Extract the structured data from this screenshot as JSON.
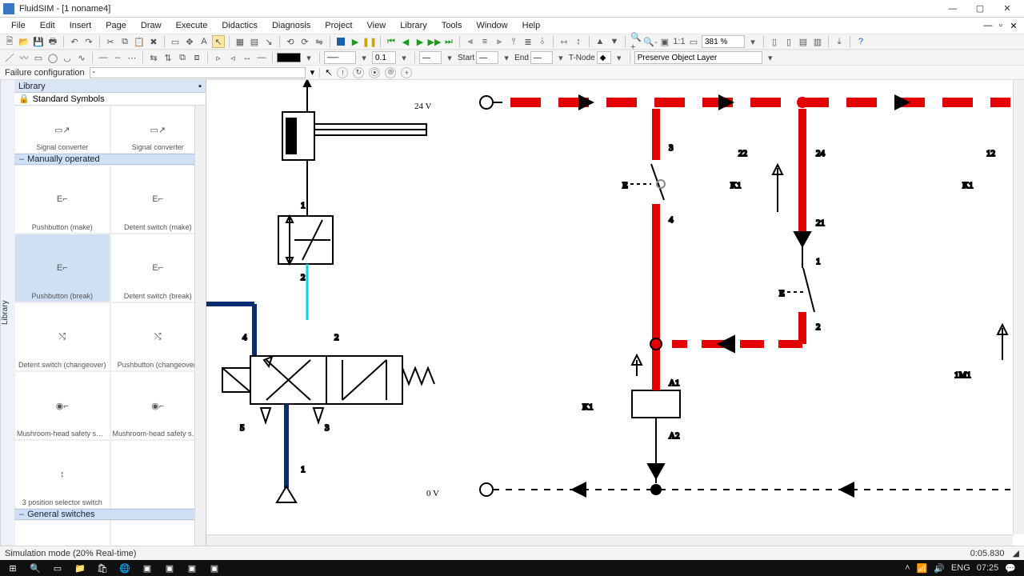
{
  "window": {
    "title": "FluidSIM - [1 noname4]"
  },
  "menu": [
    "File",
    "Edit",
    "Insert",
    "Page",
    "Draw",
    "Execute",
    "Didactics",
    "Diagnosis",
    "Project",
    "View",
    "Library",
    "Tools",
    "Window",
    "Help"
  ],
  "toolbar1": {
    "zoom": "381 %"
  },
  "toolbar2": {
    "line_weight": "0.1",
    "labels": {
      "start": "Start",
      "end": "End",
      "tnode": "T-Node",
      "preserve": "Preserve Object Layer"
    }
  },
  "failure": {
    "label": "Failure configuration",
    "value": "-"
  },
  "library": {
    "panel_title": "Library",
    "std_header": "Standard Symbols",
    "top_row": [
      "Signal converter",
      "Signal converter"
    ],
    "cat_manual": "Manually operated",
    "manual_items": [
      "Pushbutton (make)",
      "Detent switch (make)",
      "Pushbutton (break)",
      "Detent switch (break)",
      "Detent switch (changeover)",
      "Pushbutton (changeover)",
      "Mushroom-head safety sw…",
      "Mushroom-head safety sw…",
      "3 position selector switch",
      ""
    ],
    "cat_general": "General switches"
  },
  "diagram": {
    "rail_hi": "24 V",
    "rail_lo": "0 V",
    "pneu": {
      "port1": "1",
      "port2": "2",
      "port3": "3",
      "port4": "4",
      "port5": "5",
      "valve_top1": "1",
      "valve_top2": "2"
    },
    "elec": {
      "k1": "K1",
      "k1b": "K1",
      "m1": "1M1",
      "n3": "3",
      "n4": "4",
      "n22": "22",
      "n24": "24",
      "n21": "21",
      "n1": "1",
      "n2": "2",
      "n12": "12",
      "a1": "A1",
      "a2": "A2",
      "e": "E"
    }
  },
  "status": {
    "mode": "Simulation mode (20% Real-time)",
    "time": "0:05.830"
  },
  "os": {
    "lang": "ENG",
    "clock": "07:25"
  }
}
